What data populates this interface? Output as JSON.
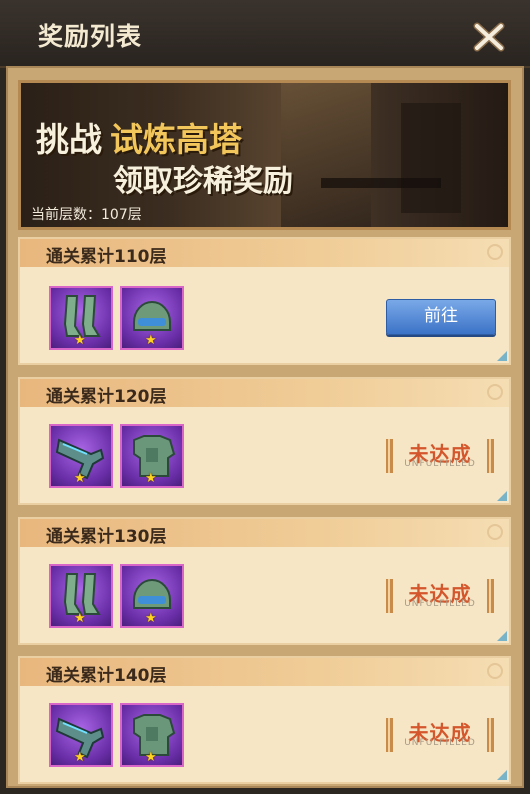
{
  "window": {
    "title": "奖励列表",
    "close_icon": "close-x-icon"
  },
  "banner": {
    "line1_prefix": "挑战",
    "line1_highlight": "试炼高塔",
    "line2": "领取珍稀奖励",
    "floor_label": "当前层数：107层"
  },
  "rewards": [
    {
      "title": "通关累计110层",
      "items": [
        "leg-armor-icon",
        "helmet-icon"
      ],
      "status": "go",
      "action_label": "前往"
    },
    {
      "title": "通关累计120层",
      "items": [
        "blaster-icon",
        "chest-armor-icon"
      ],
      "status": "unfulfilled",
      "stamp_label": "未达成",
      "stamp_sub": "UNFULFILLED"
    },
    {
      "title": "通关累计130层",
      "items": [
        "leg-armor-icon",
        "helmet-icon"
      ],
      "status": "unfulfilled",
      "stamp_label": "未达成",
      "stamp_sub": "UNFULFILLED"
    },
    {
      "title": "通关累计140层",
      "items": [
        "blaster-icon",
        "chest-armor-icon"
      ],
      "status": "unfulfilled",
      "stamp_label": "未达成",
      "stamp_sub": "UNFULFILLED"
    }
  ],
  "colors": {
    "action_button": "#4a84d6",
    "stamp_text": "#d4562c",
    "item_frame": "#8a3fc7",
    "star": "#ffd21f"
  }
}
